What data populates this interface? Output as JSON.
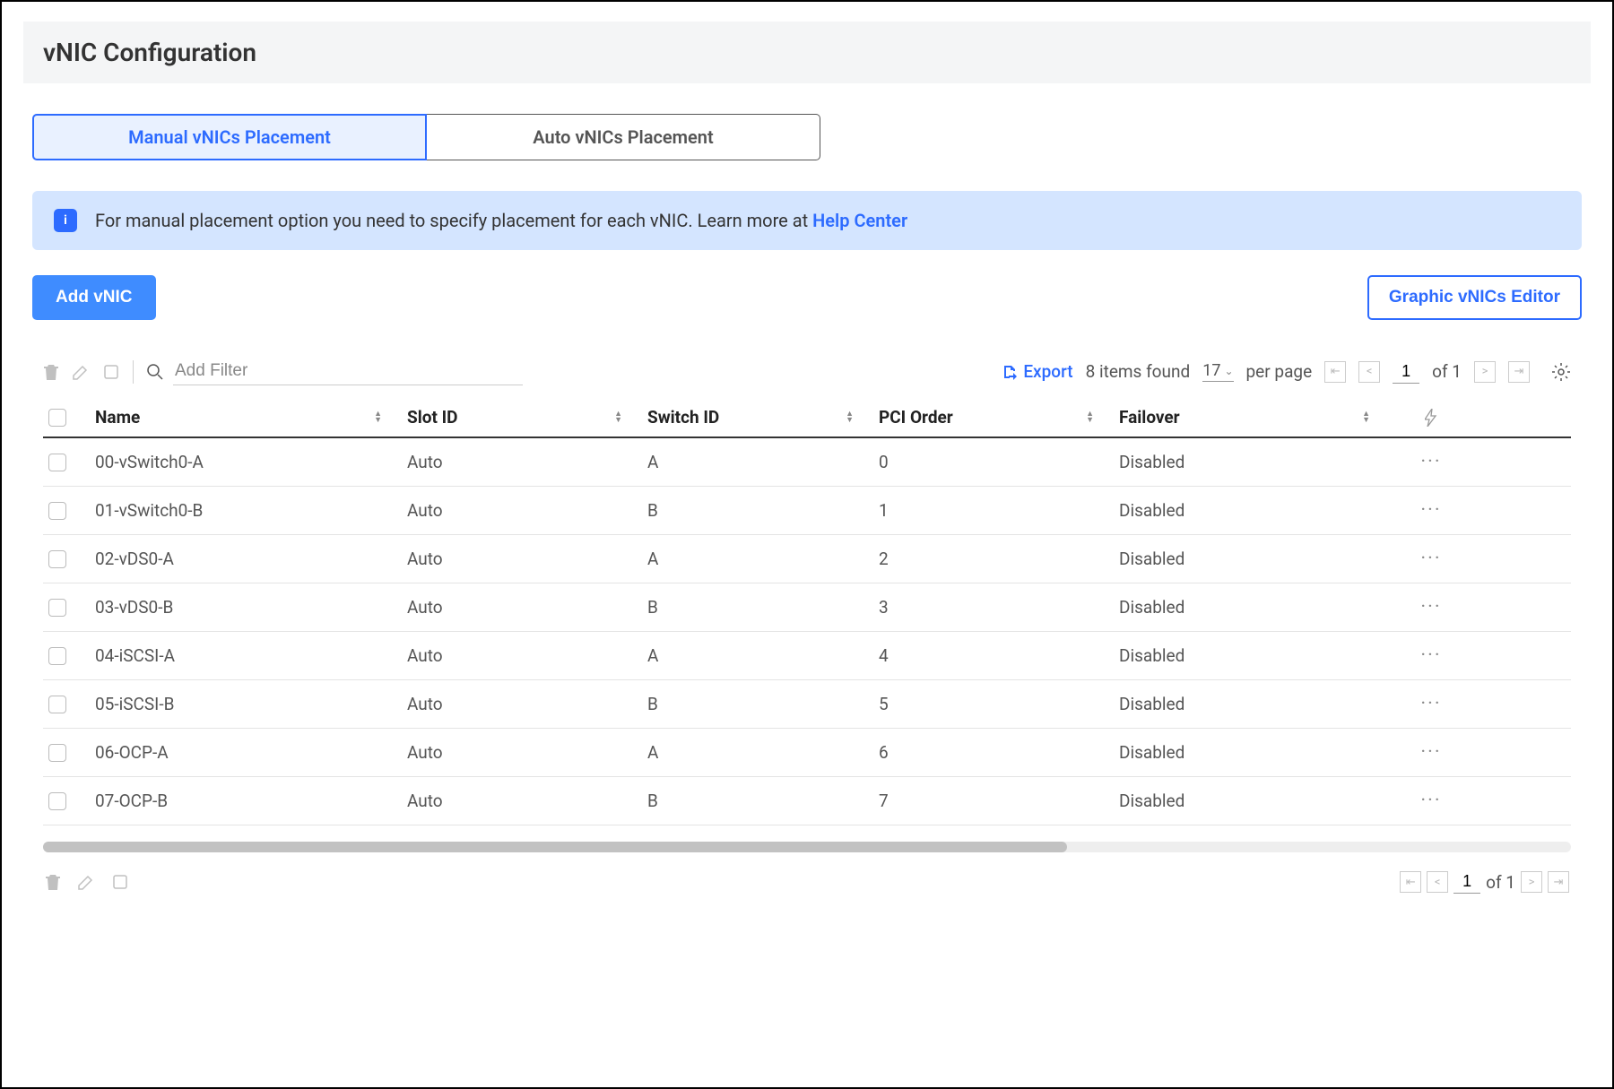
{
  "header": {
    "title": "vNIC Configuration"
  },
  "tabs": [
    {
      "label": "Manual vNICs Placement",
      "active": true
    },
    {
      "label": "Auto vNICs Placement",
      "active": false
    }
  ],
  "banner": {
    "text": "For manual placement option you need to specify placement for each vNIC. Learn more at ",
    "link": "Help Center"
  },
  "buttons": {
    "add": "Add vNIC",
    "editor": "Graphic vNICs Editor"
  },
  "toolbar": {
    "filter_placeholder": "Add Filter",
    "export_label": "Export",
    "items_found": "8 items found",
    "per_page_value": "17",
    "per_page_label": "per page",
    "page_current": "1",
    "page_of": "of 1"
  },
  "columns": [
    "Name",
    "Slot ID",
    "Switch ID",
    "PCI Order",
    "Failover"
  ],
  "rows": [
    {
      "name": "00-vSwitch0-A",
      "slot": "Auto",
      "switch": "A",
      "pci": "0",
      "failover": "Disabled"
    },
    {
      "name": "01-vSwitch0-B",
      "slot": "Auto",
      "switch": "B",
      "pci": "1",
      "failover": "Disabled"
    },
    {
      "name": "02-vDS0-A",
      "slot": "Auto",
      "switch": "A",
      "pci": "2",
      "failover": "Disabled"
    },
    {
      "name": "03-vDS0-B",
      "slot": "Auto",
      "switch": "B",
      "pci": "3",
      "failover": "Disabled"
    },
    {
      "name": "04-iSCSI-A",
      "slot": "Auto",
      "switch": "A",
      "pci": "4",
      "failover": "Disabled"
    },
    {
      "name": "05-iSCSI-B",
      "slot": "Auto",
      "switch": "B",
      "pci": "5",
      "failover": "Disabled"
    },
    {
      "name": "06-OCP-A",
      "slot": "Auto",
      "switch": "A",
      "pci": "6",
      "failover": "Disabled"
    },
    {
      "name": "07-OCP-B",
      "slot": "Auto",
      "switch": "B",
      "pci": "7",
      "failover": "Disabled"
    }
  ],
  "footer_pagination": {
    "page_current": "1",
    "page_of": "of 1"
  }
}
